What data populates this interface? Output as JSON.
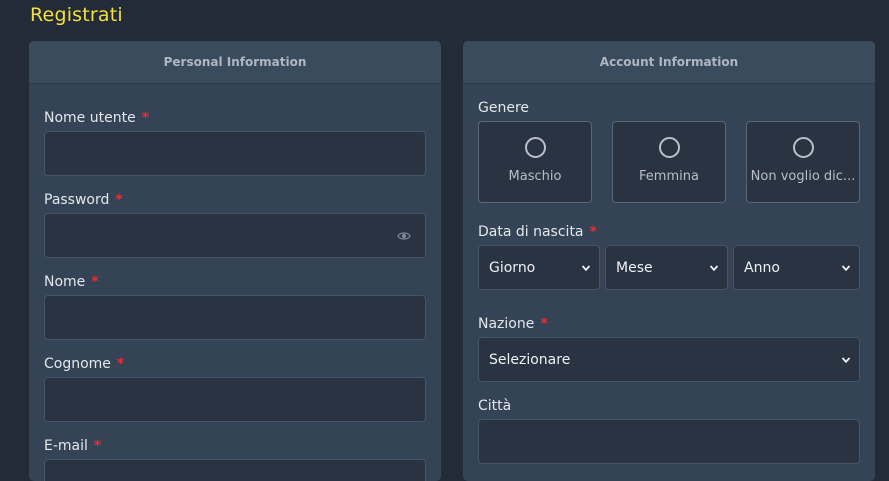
{
  "page": {
    "title": "Registrati"
  },
  "personal": {
    "header": "Personal Information",
    "fields": [
      {
        "label": "Nome utente",
        "required": "*"
      },
      {
        "label": "Password",
        "required": "*"
      },
      {
        "label": "Nome",
        "required": "*"
      },
      {
        "label": "Cognome",
        "required": "*"
      },
      {
        "label": "E-mail",
        "required": "*"
      }
    ]
  },
  "account": {
    "header": "Account Information",
    "gender": {
      "label": "Genere",
      "options": [
        "Maschio",
        "Femmina",
        "Non voglio dic..."
      ]
    },
    "birthdate": {
      "label": "Data di nascita",
      "required": "*",
      "day": "Giorno",
      "month": "Mese",
      "year": "Anno"
    },
    "country": {
      "label": "Nazione",
      "required": "*",
      "value": "Selezionare"
    },
    "city": {
      "label": "Città"
    }
  },
  "icons": {
    "password_toggle": "eye-icon",
    "dropdown": "chevron-down-icon"
  }
}
